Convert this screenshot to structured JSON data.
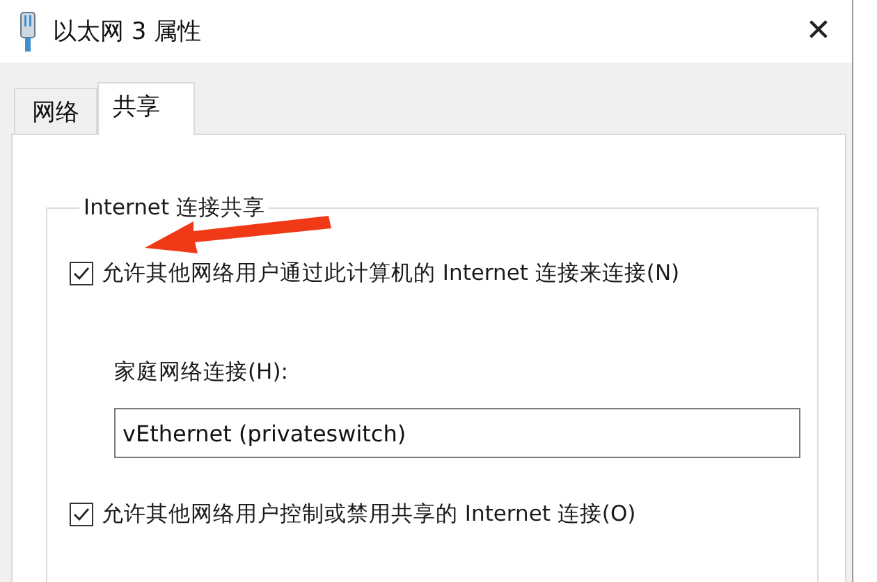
{
  "window": {
    "title": "以太网 3 属性",
    "close": "✕"
  },
  "tabs": [
    {
      "label": "网络",
      "selected": false
    },
    {
      "label": "共享",
      "selected": true
    }
  ],
  "group": {
    "title": "Internet 连接共享",
    "allow_sharing": {
      "label": "允许其他网络用户通过此计算机的 Internet 连接来连接(N)",
      "checked": true
    },
    "home_network": {
      "label": "家庭网络连接(H):",
      "value": "vEthernet (privateswitch)"
    },
    "allow_control": {
      "label": "允许其他网络用户控制或禁用共享的 Internet 连接(O)",
      "checked": true
    }
  }
}
